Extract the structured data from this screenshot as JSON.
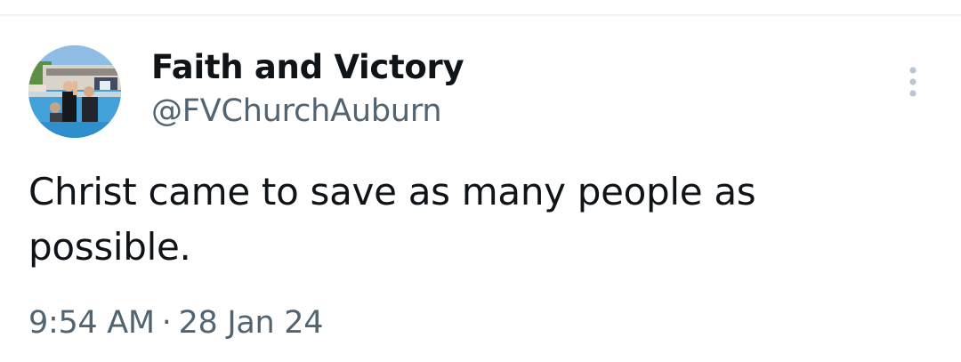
{
  "author": {
    "name": "Faith and Victory",
    "handle": "@FVChurchAuburn",
    "avatar_icon": "profile-photo"
  },
  "tweet": {
    "text_line1": "Christ came to save as many people as",
    "text_line2": "possible."
  },
  "meta": {
    "time": "9:54 AM",
    "separator": "·",
    "date": "28 Jan 24"
  },
  "actions": {
    "more_icon": "more-vertical-icon"
  },
  "colors": {
    "text_primary": "#0f1419",
    "text_secondary": "#536471",
    "divider": "#eff3f4"
  }
}
